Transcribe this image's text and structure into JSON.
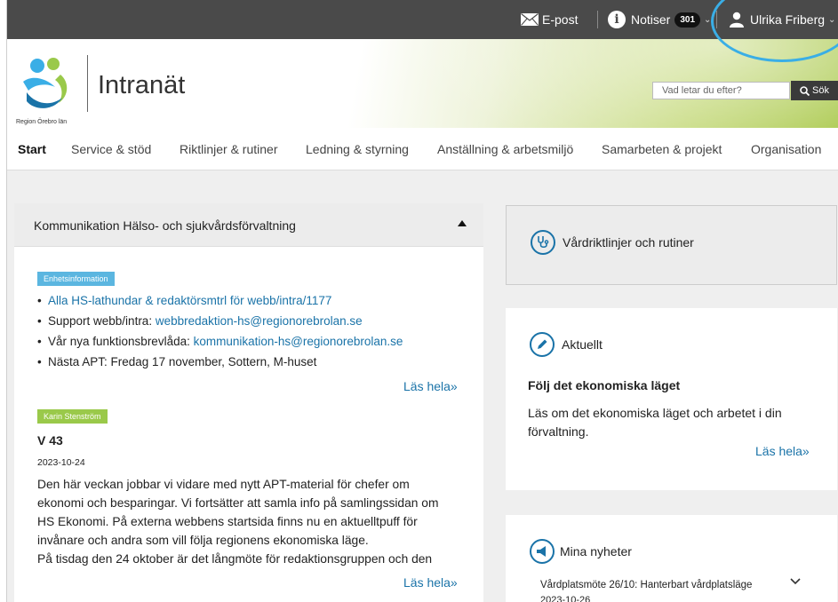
{
  "topbar": {
    "email_label": "E-post",
    "notifications_label": "Notiser",
    "notifications_count": "301",
    "user_name": "Ulrika Friberg"
  },
  "header": {
    "org_name": "Region Örebro län",
    "site_title": "Intranät",
    "search_placeholder": "Vad letar du efter?",
    "search_button": "Sök"
  },
  "nav": {
    "tabs": [
      {
        "label": "Start",
        "active": true
      },
      {
        "label": "Service & stöd"
      },
      {
        "label": "Riktlinjer & rutiner"
      },
      {
        "label": "Ledning & styrning"
      },
      {
        "label": "Anställning & arbetsmiljö"
      },
      {
        "label": "Samarbeten & projekt"
      },
      {
        "label": "Organisation"
      }
    ]
  },
  "left_panel": {
    "title": "Kommunikation Hälso- och sjukvårdsförvaltning",
    "unit_info": {
      "tag": "Enhetsinformation",
      "items": [
        {
          "text": "Alla HS-lathundar & redaktörsmtrl för webb/intra/1177"
        },
        {
          "prefix": "Support webb/intra: ",
          "link": "webbredaktion-hs@regionorebrolan.se"
        },
        {
          "prefix": "Vår nya funktionsbrevlåda: ",
          "link": "kommunikation-hs@regionorebrolan.se"
        },
        {
          "text": "Nästa APT: Fredag 17 november, Sottern, M-huset"
        }
      ],
      "read_more": "Läs hela»"
    },
    "post": {
      "author_tag": "Karin Stenström",
      "title": "V 43",
      "date": "2023-10-24",
      "lines": [
        "Den här veckan jobbar vi vidare med nytt APT-material för chefer om",
        "ekonomi och besparingar. Vi fortsätter att samla info på samlingssidan om",
        "HS Ekonomi. På externa webbens startsida finns nu en aktuelltpuff för",
        "invånare och andra som vill följa regionens ekonomiska läge.",
        "På tisdag den 24 oktober är det långmöte för redaktionsgruppen och den"
      ],
      "read_more": "Läs hela»"
    }
  },
  "right_panel": {
    "guidelines": {
      "title": "Vårdriktlinjer och rutiner"
    },
    "news": {
      "title": "Aktuellt",
      "headline": "Följ det ekonomiska läget",
      "body_lines": [
        "Läs om det ekonomiska läget och arbetet i din",
        "förvaltning."
      ],
      "read_more": "Läs hela»"
    },
    "my_news": {
      "title": "Mina nyheter",
      "item_title": "Vårdplatsmöte 26/10: Hanterbart vårdplatsläge",
      "item_date": "2023-10-26"
    }
  },
  "colors": {
    "topbar": "#4a4a4a",
    "link": "#1a73a8",
    "tag_blue": "#5bb6e0",
    "tag_green": "#9ac94a",
    "highlight": "#3aaee6"
  }
}
